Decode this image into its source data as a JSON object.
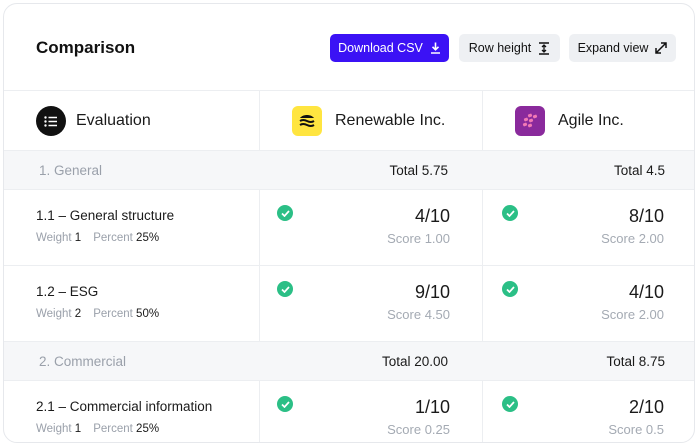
{
  "header": {
    "title": "Comparison",
    "download_label": "Download CSV",
    "row_height_label": "Row height",
    "expand_label": "Expand view"
  },
  "columns": {
    "evaluation": "Evaluation",
    "vendor1": "Renewable Inc.",
    "vendor2": "Agile Inc."
  },
  "colors": {
    "accent": "#3b12f5",
    "check": "#2bbf86",
    "renewable_logo": "#ffe540",
    "agile_logo": "#8a2a9c"
  },
  "sections": [
    {
      "label": "1. General",
      "total1": "Total 5.75",
      "total2": "Total 4.5",
      "items": [
        {
          "title": "1.1 – General structure",
          "weight_label": "Weight",
          "weight": "1",
          "percent_label": "Percent",
          "percent": "25%",
          "score1": "4/10",
          "sub1": "Score 1.00",
          "score2": "8/10",
          "sub2": "Score 2.00"
        },
        {
          "title": "1.2 – ESG",
          "weight_label": "Weight",
          "weight": "2",
          "percent_label": "Percent",
          "percent": "50%",
          "score1": "9/10",
          "sub1": "Score 4.50",
          "score2": "4/10",
          "sub2": "Score 2.00"
        }
      ]
    },
    {
      "label": "2. Commercial",
      "total1": "Total 20.00",
      "total2": "Total 8.75",
      "items": [
        {
          "title": "2.1 – Commercial information",
          "weight_label": "Weight",
          "weight": "1",
          "percent_label": "Percent",
          "percent": "25%",
          "score1": "1/10",
          "sub1": "Score 0.25",
          "score2": "2/10",
          "sub2": "Score 0.5"
        }
      ]
    }
  ]
}
